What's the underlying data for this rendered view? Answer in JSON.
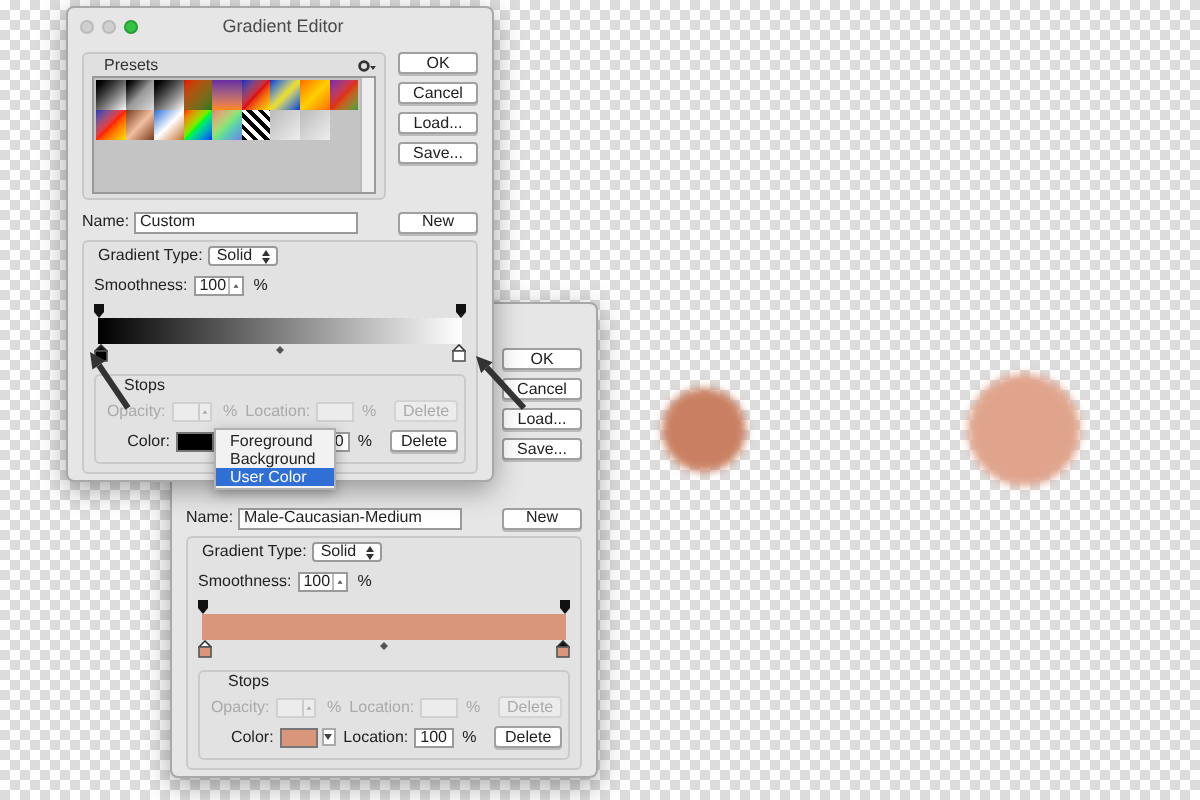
{
  "dialogs": [
    {
      "title": "Gradient Editor",
      "presets_label": "Presets",
      "buttons": [
        "OK",
        "Cancel",
        "Load...",
        "Save..."
      ],
      "name_label": "Name:",
      "name_value": "Custom",
      "new_button": "New",
      "gradient_type_label": "Gradient Type:",
      "gradient_type_value": "Solid",
      "smoothness_label": "Smoothness:",
      "smoothness_value": "100",
      "smoothness_unit": "%",
      "color_stops": [
        {
          "color": "#000000",
          "selected": true
        },
        {
          "color": "#ffffff",
          "selected": false
        }
      ],
      "stops": {
        "label": "Stops",
        "opacity_row": {
          "disabled": true,
          "label": "Opacity:",
          "unit": "%",
          "location_label": "Location:",
          "location_unit": "%",
          "delete": "Delete"
        },
        "color_row": {
          "disabled": false,
          "label": "Color:",
          "color": "#000000",
          "location_value": "0",
          "location_unit": "%",
          "delete": "Delete"
        }
      },
      "color_menu": [
        {
          "label": "Foreground",
          "selected": false
        },
        {
          "label": "Background",
          "selected": false
        },
        {
          "label": "User Color",
          "selected": true
        }
      ]
    },
    {
      "buttons": [
        "OK",
        "Cancel",
        "Load...",
        "Save..."
      ],
      "name_label": "Name:",
      "name_value": "Male-Caucasian-Medium",
      "new_button": "New",
      "gradient_type_label": "Gradient Type:",
      "gradient_type_value": "Solid",
      "smoothness_label": "Smoothness:",
      "smoothness_value": "100",
      "smoothness_unit": "%",
      "color_stops": [
        {
          "color": "#d9967a",
          "selected": false
        },
        {
          "color": "#d9967a",
          "selected": true
        }
      ],
      "stops": {
        "label": "Stops",
        "opacity_row": {
          "disabled": true,
          "label": "Opacity:",
          "unit": "%",
          "location_label": "Location:",
          "location_unit": "%",
          "delete": "Delete"
        },
        "color_row": {
          "disabled": false,
          "label": "Color:",
          "color": "#d9967a",
          "location_label": "Location:",
          "location_value": "100",
          "location_unit": "%",
          "delete": "Delete"
        }
      }
    }
  ],
  "circles": [
    {
      "color": "#c98062"
    },
    {
      "color": "#e0a48c"
    }
  ]
}
